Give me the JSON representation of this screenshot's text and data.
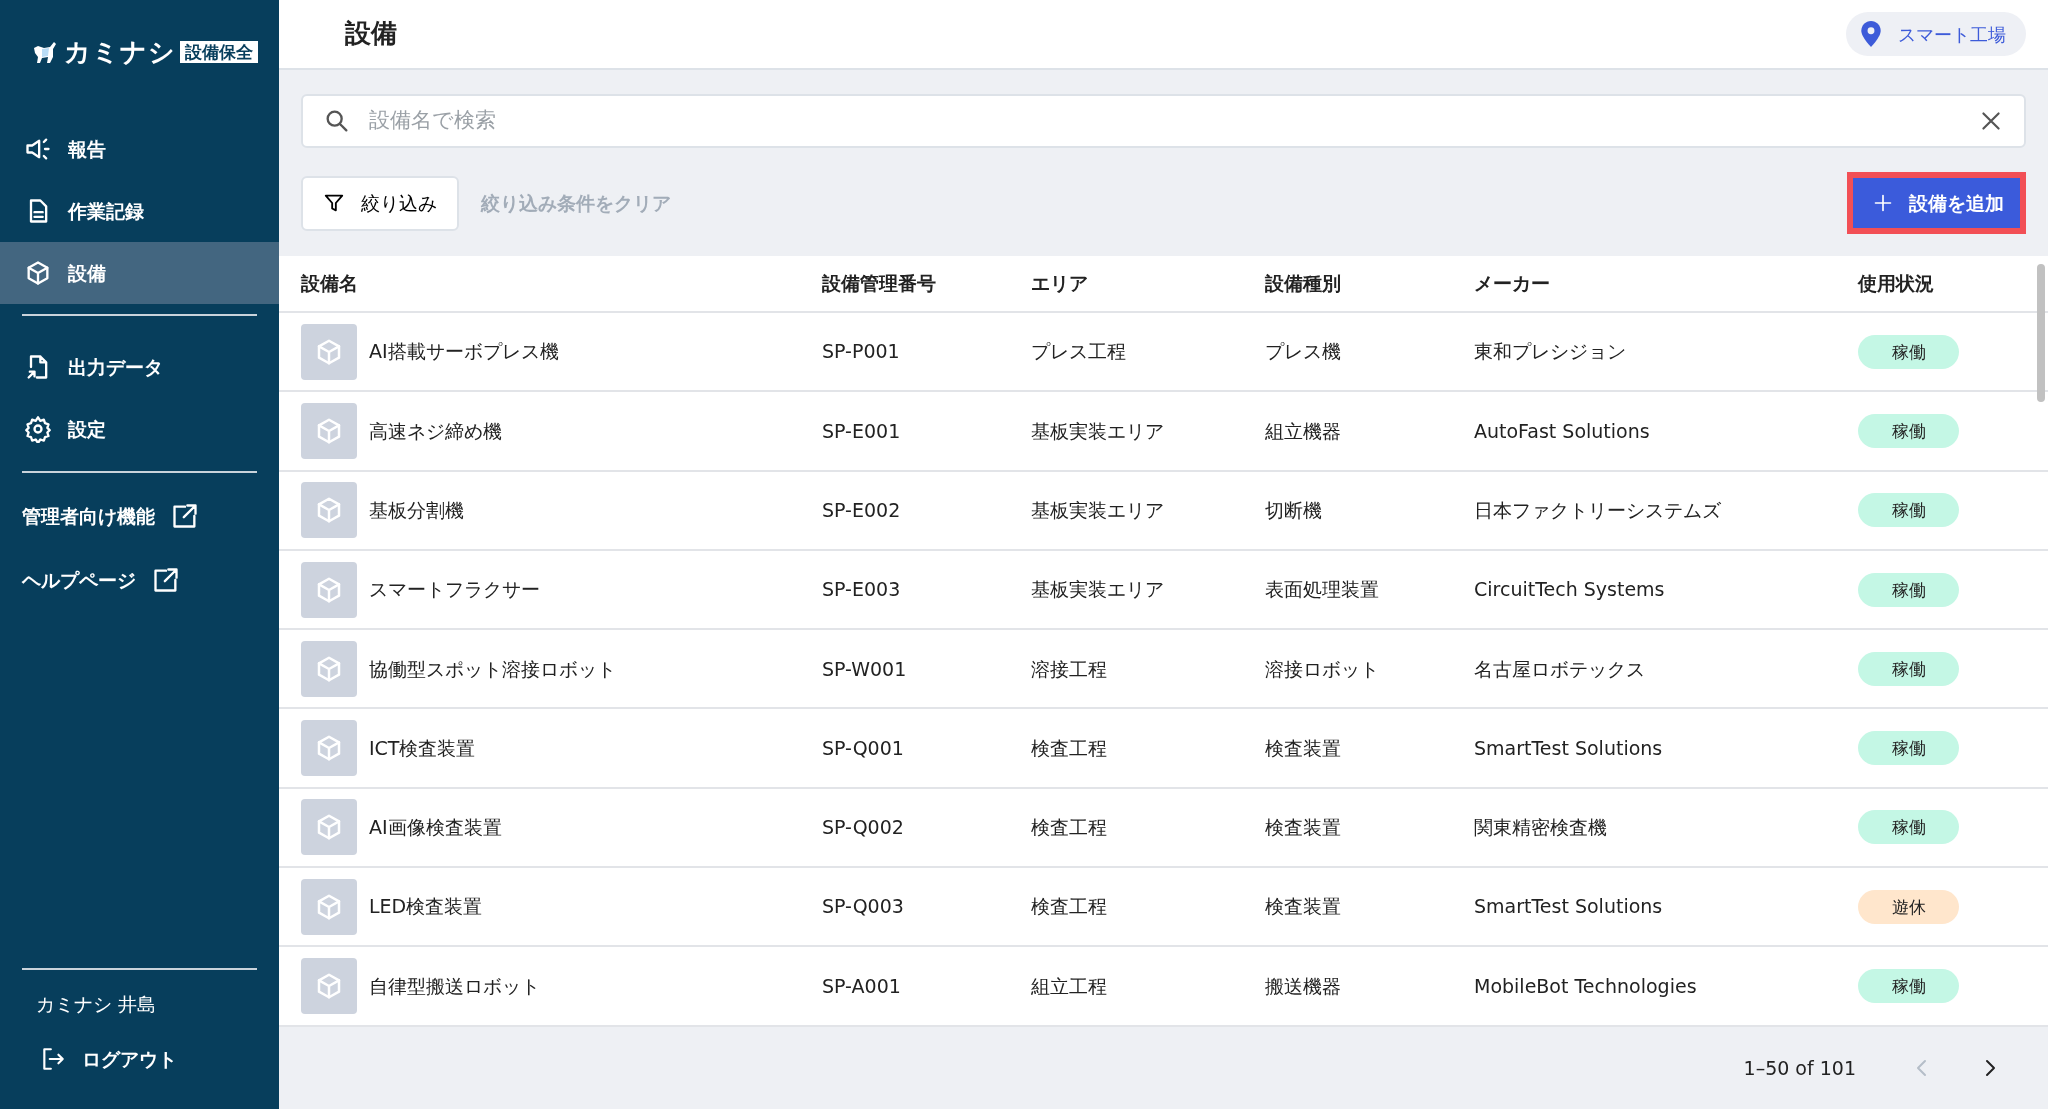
{
  "logo": {
    "name": "カミナシ",
    "tag": "設備保全"
  },
  "sidebar": {
    "items": [
      {
        "label": "報告",
        "kind": "nav",
        "selected": false
      },
      {
        "label": "作業記録",
        "kind": "nav",
        "selected": false
      },
      {
        "label": "設備",
        "kind": "nav",
        "selected": true
      },
      {
        "kind": "divider"
      },
      {
        "label": "出力データ",
        "kind": "nav",
        "selected": false
      },
      {
        "label": "設定",
        "kind": "nav",
        "selected": false
      },
      {
        "kind": "divider"
      },
      {
        "label": "管理者向け機能",
        "kind": "external"
      },
      {
        "label": "ヘルプページ",
        "kind": "external"
      }
    ],
    "user": "カミナシ 井島",
    "logout": "ログアウト"
  },
  "header": {
    "title": "設備",
    "location": "スマート工場"
  },
  "search": {
    "placeholder": "設備名で検索"
  },
  "filter_button": "絞り込み",
  "clear_filters": "絞り込み条件をクリア",
  "add_button": "設備を追加",
  "table": {
    "columns": [
      "設備名",
      "設備管理番号",
      "エリア",
      "設備種別",
      "メーカー",
      "使用状況"
    ],
    "rows": [
      {
        "name": "AI搭載サーボプレス機",
        "code": "SP-P001",
        "area": "プレス工程",
        "type": "プレス機",
        "maker": "東和プレシジョン",
        "status": {
          "label": "稼働",
          "kind": "active"
        }
      },
      {
        "name": "高速ネジ締め機",
        "code": "SP-E001",
        "area": "基板実装エリア",
        "type": "組立機器",
        "maker": "AutoFast Solutions",
        "status": {
          "label": "稼働",
          "kind": "active"
        }
      },
      {
        "name": "基板分割機",
        "code": "SP-E002",
        "area": "基板実装エリア",
        "type": "切断機",
        "maker": "日本ファクトリーシステムズ",
        "status": {
          "label": "稼働",
          "kind": "active"
        }
      },
      {
        "name": "スマートフラクサー",
        "code": "SP-E003",
        "area": "基板実装エリア",
        "type": "表面処理装置",
        "maker": "CircuitTech Systems",
        "status": {
          "label": "稼働",
          "kind": "active"
        }
      },
      {
        "name": "協働型スポット溶接ロボット",
        "code": "SP-W001",
        "area": "溶接工程",
        "type": "溶接ロボット",
        "maker": "名古屋ロボテックス",
        "status": {
          "label": "稼働",
          "kind": "active"
        }
      },
      {
        "name": "ICT検査装置",
        "code": "SP-Q001",
        "area": "検査工程",
        "type": "検査装置",
        "maker": "SmartTest Solutions",
        "status": {
          "label": "稼働",
          "kind": "active"
        }
      },
      {
        "name": "AI画像検査装置",
        "code": "SP-Q002",
        "area": "検査工程",
        "type": "検査装置",
        "maker": "関東精密検査機",
        "status": {
          "label": "稼働",
          "kind": "active"
        }
      },
      {
        "name": "LED検査装置",
        "code": "SP-Q003",
        "area": "検査工程",
        "type": "検査装置",
        "maker": "SmartTest Solutions",
        "status": {
          "label": "遊休",
          "kind": "idle"
        }
      },
      {
        "name": "自律型搬送ロボット",
        "code": "SP-A001",
        "area": "組立工程",
        "type": "搬送機器",
        "maker": "MobileBot Technologies",
        "status": {
          "label": "稼働",
          "kind": "active"
        }
      }
    ]
  },
  "pagination": {
    "range": "1–50 of 101",
    "prev_disabled": true,
    "next_disabled": false
  }
}
